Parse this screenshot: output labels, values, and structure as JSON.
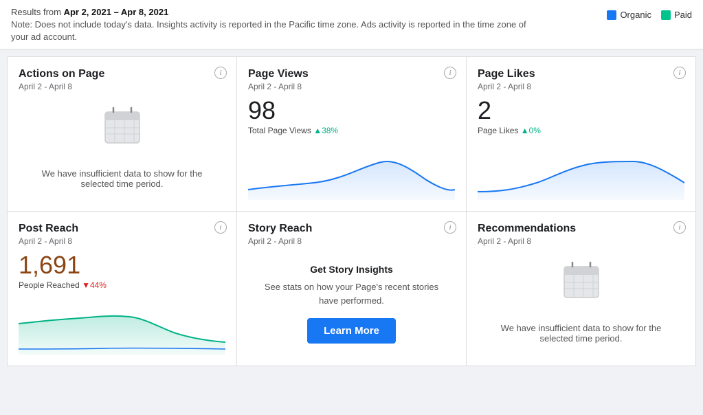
{
  "header": {
    "results_label": "Results from ",
    "date_range": "Apr 2, 2021 – Apr 8, 2021",
    "note": "Note: Does not include today's data. Insights activity is reported in the Pacific time zone. Ads activity is reported in the time zone of your ad account.",
    "legend_organic": "Organic",
    "legend_paid": "Paid"
  },
  "cards": {
    "actions_on_page": {
      "title": "Actions on Page",
      "date": "April 2 - April 8",
      "insufficient_text": "We have insufficient data to show for the selected time period.",
      "info_label": "i"
    },
    "page_views": {
      "title": "Page Views",
      "date": "April 2 - April 8",
      "number": "98",
      "metric_label": "Total Page Views",
      "change": "▲38%",
      "change_type": "up",
      "info_label": "i"
    },
    "page_likes": {
      "title": "Page Likes",
      "date": "April 2 - April 8",
      "number": "2",
      "metric_label": "Page Likes",
      "change": "▲0%",
      "change_type": "up",
      "info_label": "i"
    },
    "post_reach": {
      "title": "Post Reach",
      "date": "April 2 - April 8",
      "number": "1,691",
      "metric_label": "People Reached",
      "change": "▼44%",
      "change_type": "down",
      "info_label": "i"
    },
    "story_reach": {
      "title": "Story Reach",
      "date": "April 2 - April 8",
      "cta_title": "Get Story Insights",
      "cta_desc": "See stats on how your Page's recent stories have performed.",
      "cta_button": "Learn More",
      "info_label": "i"
    },
    "recommendations": {
      "title": "Recommendations",
      "date": "April 2 - April 8",
      "insufficient_text": "We have insufficient data to show for the selected time period.",
      "info_label": "i"
    }
  }
}
